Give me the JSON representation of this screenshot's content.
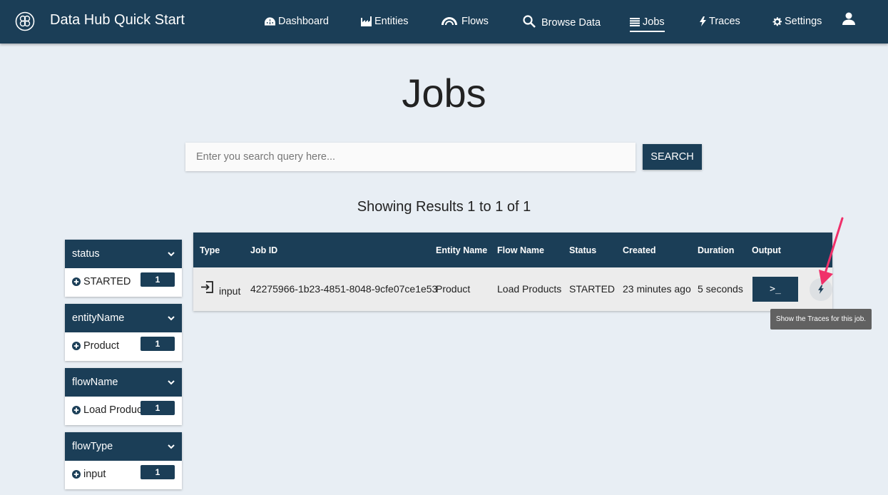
{
  "header": {
    "app_title": "Data Hub Quick Start",
    "nav": [
      {
        "label": "Dashboard",
        "icon": "dashboard-icon"
      },
      {
        "label": "Entities",
        "icon": "entities-icon"
      },
      {
        "label": "Flows",
        "icon": "flows-icon"
      },
      {
        "label": "Browse Data",
        "icon": "search-icon"
      },
      {
        "label": "Jobs",
        "icon": "jobs-icon",
        "active": true
      },
      {
        "label": "Traces",
        "icon": "bolt-icon"
      },
      {
        "label": "Settings",
        "icon": "gear-icon"
      }
    ],
    "user_icon": "user-icon"
  },
  "page": {
    "title": "Jobs",
    "search": {
      "placeholder": "Enter you search query here...",
      "value": "",
      "button_label": "SEARCH"
    },
    "results_summary": "Showing Results 1 to 1 of 1"
  },
  "facets": [
    {
      "name": "status",
      "value": "STARTED",
      "count": "1"
    },
    {
      "name": "entityName",
      "value": "Product",
      "count": "1"
    },
    {
      "name": "flowName",
      "value": "Load Products",
      "count": "1"
    },
    {
      "name": "flowType",
      "value": "input",
      "count": "1"
    }
  ],
  "table": {
    "headers": [
      "Type",
      "Job ID",
      "Entity Name",
      "Flow Name",
      "Status",
      "Created",
      "Duration",
      "Output"
    ],
    "rows": [
      {
        "type": "input",
        "job_id": "42275966-1b23-4851-8048-9cfe07ce1e53",
        "entity_name": "Product",
        "flow_name": "Load Products",
        "status": "STARTED",
        "created": "23 minutes ago",
        "duration": "5 seconds",
        "output_label": ">_"
      }
    ]
  },
  "tooltip": "Show the Traces for this job.",
  "colors": {
    "primary": "#1b3e57",
    "background": "#e8eef4",
    "annotation": "#f0306a"
  }
}
